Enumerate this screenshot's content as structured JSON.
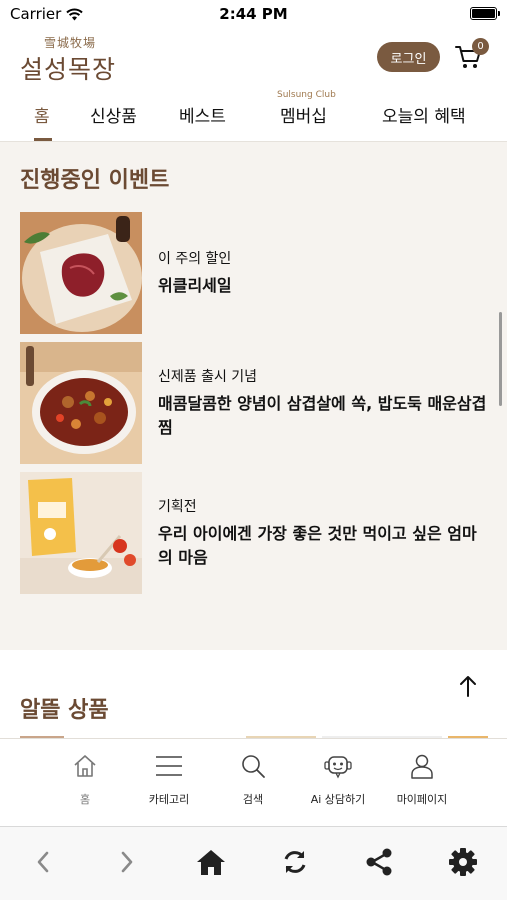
{
  "status": {
    "carrier": "Carrier",
    "time": "2:44 PM"
  },
  "header": {
    "logo_hanja": "雪城牧場",
    "logo_name": "설성목장",
    "login_label": "로그인",
    "cart_count": "0"
  },
  "nav": {
    "tabs": [
      {
        "label": "홈"
      },
      {
        "label": "신상품"
      },
      {
        "label": "베스트"
      },
      {
        "label": "멤버십"
      },
      {
        "label": "오늘의 혜택"
      }
    ],
    "club_label": "Sulsung Club"
  },
  "events": {
    "title": "진행중인 이벤트",
    "items": [
      {
        "sub": "이 주의 할인",
        "title": "위클리세일"
      },
      {
        "sub": "신제품 출시 기념",
        "title": "매콤달콤한 양념이 삼겹살에 쏙, 밥도둑 매운삼겹찜"
      },
      {
        "sub": "기획전",
        "title": "우리 아이에겐 가장 좋은 것만 먹이고 싶은 엄마의 마음"
      }
    ]
  },
  "products": {
    "title": "알뜰 상품"
  },
  "tabbar": {
    "items": [
      {
        "label": "홈",
        "icon": "home-icon"
      },
      {
        "label": "카테고리",
        "icon": "menu-icon"
      },
      {
        "label": "검색",
        "icon": "search-icon"
      },
      {
        "label": "Ai 상담하기",
        "icon": "ai-chat-icon"
      },
      {
        "label": "마이페이지",
        "icon": "user-icon"
      }
    ]
  },
  "toolbar": {
    "items": [
      "back-icon",
      "forward-icon",
      "home-icon",
      "refresh-icon",
      "share-icon",
      "settings-icon"
    ]
  },
  "colors": {
    "brand": "#7a5a40",
    "background": "#f6f3ef"
  }
}
